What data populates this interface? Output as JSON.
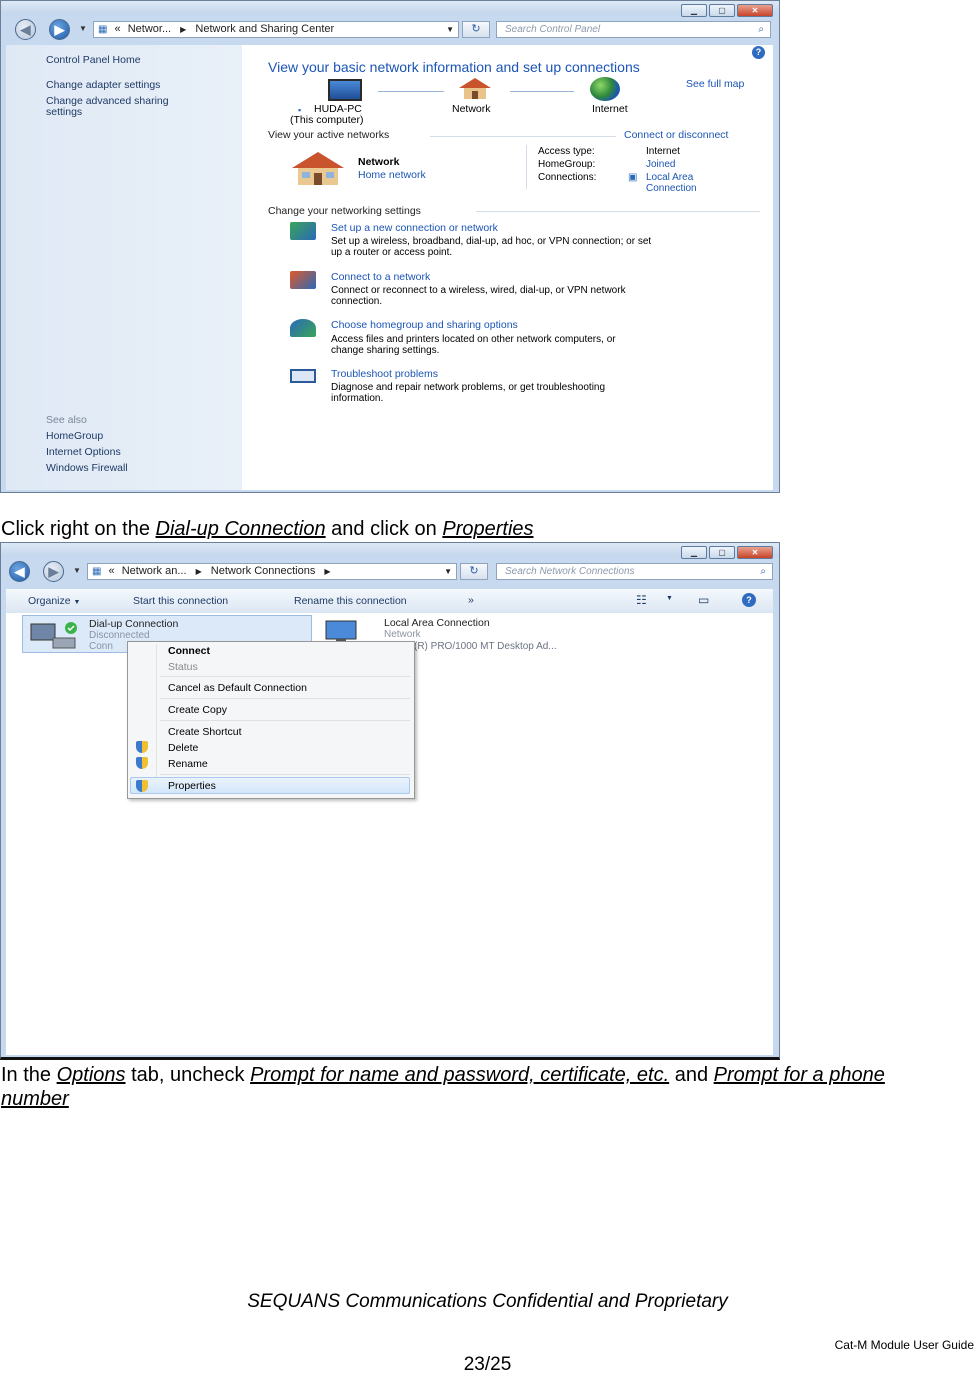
{
  "window1": {
    "breadcrumb": [
      "Networ...",
      "Network and Sharing Center"
    ],
    "search_placeholder": "Search Control Panel",
    "sidebar": {
      "home": "Control Panel Home",
      "adapter": "Change adapter settings",
      "advanced_line1": "Change advanced sharing",
      "advanced_line2": "settings",
      "see_also": "See also",
      "homegroup": "HomeGroup",
      "internet_options": "Internet Options",
      "firewall": "Windows Firewall"
    },
    "heading": "View your basic network information and set up connections",
    "see_full_map": "See full map",
    "map": {
      "computer": "HUDA-PC",
      "computer_sub": "(This computer)",
      "network": "Network",
      "internet": "Internet"
    },
    "active_label": "View your active networks",
    "connect_disconnect": "Connect or disconnect",
    "active": {
      "name": "Network",
      "type": "Home network",
      "access_type_label": "Access type:",
      "access_type_value": "Internet",
      "homegroup_label": "HomeGroup:",
      "homegroup_value": "Joined",
      "connections_label": "Connections:",
      "connections_value_1": "Local Area",
      "connections_value_2": "Connection"
    },
    "change_label": "Change your networking settings",
    "tasks": [
      {
        "title": "Set up a new connection or network",
        "desc1": "Set up a wireless, broadband, dial-up, ad hoc, or VPN connection; or set",
        "desc2": "up a router or access point."
      },
      {
        "title": "Connect to a network",
        "desc1": "Connect or reconnect to a wireless, wired, dial-up, or VPN network",
        "desc2": "connection."
      },
      {
        "title": "Choose homegroup and sharing options",
        "desc1": "Access files and printers located on other network computers, or",
        "desc2": "change sharing settings."
      },
      {
        "title": "Troubleshoot problems",
        "desc1": "Diagnose and repair network problems, or get troubleshooting",
        "desc2": "information."
      }
    ]
  },
  "instruction1": {
    "pre": "Click right on the ",
    "link1": "Dial-up Connection",
    "mid": " and click on ",
    "link2": "Properties"
  },
  "window2": {
    "breadcrumb": [
      "Network an...",
      "Network Connections"
    ],
    "search_placeholder": "Search Network Connections",
    "toolbar": {
      "organize": "Organize",
      "start": "Start this connection",
      "rename": "Rename this connection",
      "more": "»"
    },
    "items": [
      {
        "name": "Dial-up Connection",
        "status": "Disconnected",
        "device": "Conn"
      },
      {
        "name": "Local Area Connection",
        "status": "Network",
        "device": "(R) PRO/1000 MT Desktop Ad..."
      }
    ],
    "context_menu": [
      "Connect",
      "Status",
      "Cancel as Default Connection",
      "Create Copy",
      "Create Shortcut",
      "Delete",
      "Rename",
      "Properties"
    ]
  },
  "instruction2": {
    "pre": "In  the ",
    "link1": "Options",
    "mid1": " tab,  uncheck ",
    "link2": "Prompt  for  name  and  password,  certificate,  etc.",
    "mid2": " and ",
    "link3": "Prompt  for  a  phone",
    "link3b": "number"
  },
  "footer": {
    "confidential": "SEQUANS Communications Confidential and Proprietary",
    "guide": "Cat-M Module User Guide",
    "page": "23/25"
  }
}
